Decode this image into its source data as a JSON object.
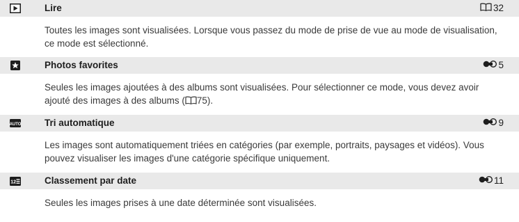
{
  "sections": [
    {
      "icon": "playback-icon",
      "title": "Lire",
      "ref_icon": "book-icon",
      "ref": "32",
      "description": "Toutes les images sont visualisées. Lorsque vous passez du mode de prise de vue au mode de visualisation, ce mode est sélectionné."
    },
    {
      "icon": "favorites-star-icon",
      "title": "Photos favorites",
      "ref_icon": "reference-link-icon",
      "ref": "5",
      "description": "Seules les images ajoutées à des albums sont visualisées. Pour sélectionner ce mode, vous devez avoir ajouté des images à des albums (",
      "description_ref_icon": "book-icon",
      "description_ref": "75",
      "description_end": ")."
    },
    {
      "icon": "auto-sort-icon",
      "title": "Tri automatique",
      "ref_icon": "reference-link-icon",
      "ref": "9",
      "description": "Les images sont automatiquement triées en catégories (par exemple, portraits, paysages et vidéos). Vous pouvez visualiser les images d'une catégorie spécifique uniquement."
    },
    {
      "icon": "list-by-date-icon",
      "title": "Classement par date",
      "ref_icon": "reference-link-icon",
      "ref": "11",
      "description": "Seules les images prises à une date déterminée sont visualisées."
    }
  ]
}
